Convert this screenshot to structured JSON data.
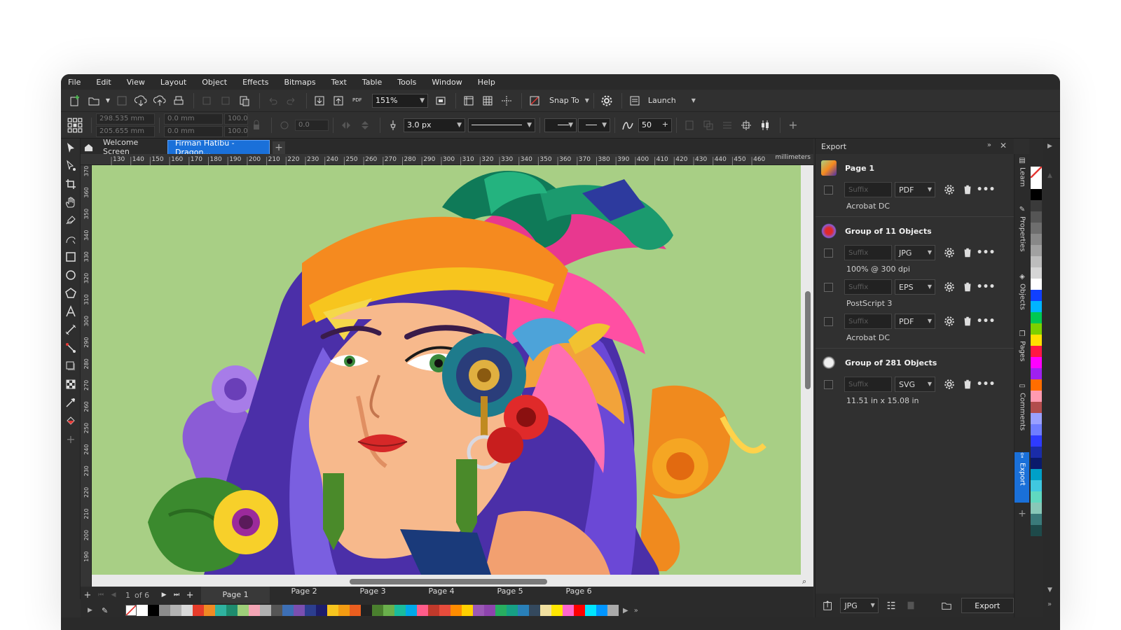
{
  "menu": [
    "File",
    "Edit",
    "View",
    "Layout",
    "Object",
    "Effects",
    "Bitmaps",
    "Text",
    "Table",
    "Tools",
    "Window",
    "Help"
  ],
  "toolbar": {
    "zoom": "151%",
    "snap_to": "Snap To",
    "launch": "Launch"
  },
  "property_bar": {
    "x": "298.535 mm",
    "y": "205.655 mm",
    "w": "0.0 mm",
    "h": "0.0 mm",
    "sx": "100.0",
    "sy": "100.0",
    "angle": "0.0",
    "outline_width": "3.0 px",
    "smooth": "50"
  },
  "tabs": {
    "welcome": "Welcome Screen",
    "document": "Firman Hatibu - Dragon..."
  },
  "ruler": {
    "h_ticks": [
      "130",
      "140",
      "150",
      "160",
      "170",
      "180",
      "190",
      "200",
      "210",
      "220",
      "230",
      "240",
      "250",
      "260",
      "270",
      "280",
      "290",
      "300",
      "310",
      "320",
      "330",
      "340",
      "350",
      "360",
      "370",
      "380",
      "390",
      "400",
      "410",
      "420",
      "430",
      "440",
      "450",
      "460"
    ],
    "unit": "millimeters",
    "v_ticks": [
      "370",
      "360",
      "350",
      "340",
      "330",
      "320",
      "310",
      "300",
      "290",
      "280",
      "270",
      "260",
      "250",
      "240",
      "230",
      "220",
      "210",
      "200",
      "190"
    ]
  },
  "pages": {
    "counter": "1",
    "of_label": "of 6",
    "items": [
      "Page 1",
      "Page 2",
      "Page 3",
      "Page 4",
      "Page 5",
      "Page 6"
    ]
  },
  "export_panel": {
    "title": "Export",
    "suffix_placeholder": "Suffix",
    "objects": [
      {
        "name": "Page 1",
        "rows": [
          {
            "format": "PDF",
            "detail": "Acrobat DC"
          }
        ]
      },
      {
        "name": "Group of 11 Objects",
        "rows": [
          {
            "format": "JPG",
            "detail": "100% @ 300 dpi"
          },
          {
            "format": "EPS",
            "detail": "PostScript 3"
          },
          {
            "format": "PDF",
            "detail": "Acrobat DC"
          }
        ]
      },
      {
        "name": "Group of 281 Objects",
        "rows": [
          {
            "format": "SVG",
            "detail": "11.51 in x 15.08 in"
          }
        ]
      }
    ],
    "footer_format": "JPG",
    "export_button": "Export"
  },
  "dock": [
    "Learn",
    "Properties",
    "Objects",
    "Pages",
    "Comments",
    "Export"
  ],
  "colors": {
    "accent": "#1a70d9",
    "palette_bottom": [
      "#ffffff",
      "#000000",
      "#8c8c8c",
      "#b3b3b3",
      "#d9d9d9",
      "#e63c2a",
      "#f08a24",
      "#2fb3a0",
      "#1e8c6e",
      "#9ecf7a",
      "#f3a5b5",
      "#b0b0b0",
      "#555555",
      "#3d6fb5",
      "#7a4fb0",
      "#2c3e8f",
      "#1d1d6b",
      "#f7c51e",
      "#f39c12",
      "#ea5e1f",
      "#222222",
      "#4a7f2e",
      "#6ab04c",
      "#1abc9c",
      "#00a8e8",
      "#ff5c8a",
      "#c0392b",
      "#e74c3c",
      "#ff8c00",
      "#ffd000",
      "#9b59b6",
      "#8e44ad",
      "#27ae60",
      "#16a085",
      "#2980b9",
      "#34495e",
      "#f1e0a0",
      "#ffe600",
      "#ff66cc",
      "#ff0000",
      "#00e5ff",
      "#0095ff",
      "#aaaaaa"
    ],
    "palette_right": [
      "#ffffff",
      "#000000",
      "#3a3a3a",
      "#555555",
      "#6e6e6e",
      "#888888",
      "#a1a1a1",
      "#bdbdbd",
      "#d6d6d6",
      "#ffffff",
      "#1040ff",
      "#00b4ff",
      "#00c853",
      "#7cd000",
      "#ffe000",
      "#ff1744",
      "#ff00ff",
      "#a020f0",
      "#ff6d00",
      "#ff9ab0",
      "#b24d4d",
      "#9aa0ff",
      "#6f7dff",
      "#2e3bff",
      "#1a2ca8",
      "#0a1a6b",
      "#00a0c8",
      "#40c8e0",
      "#60d8c0",
      "#88c8b8",
      "#3a7a7a",
      "#1e4a4a"
    ]
  }
}
